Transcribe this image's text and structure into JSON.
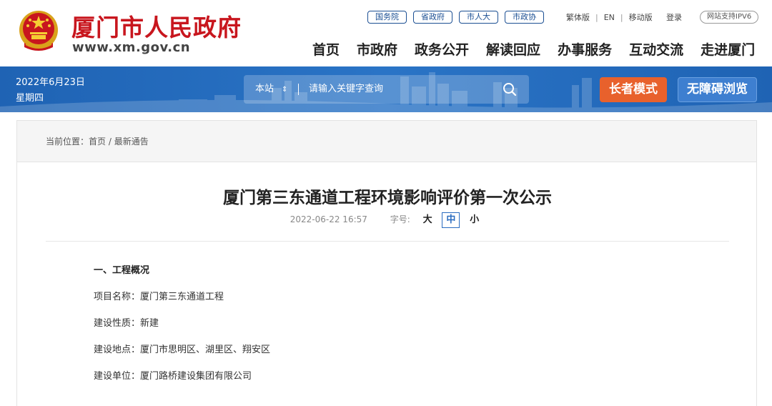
{
  "header": {
    "site_title": "厦门市人民政府",
    "site_domain": "www.xm.gov.cn",
    "top_links": [
      "国务院",
      "省政府",
      "市人大",
      "市政协"
    ],
    "util_links": [
      "繁体版",
      "EN",
      "移动版"
    ],
    "login": "登录",
    "ipv6": "网站支持IPV6",
    "nav": [
      "首页",
      "市政府",
      "政务公开",
      "解读回应",
      "办事服务",
      "互动交流",
      "走进厦门"
    ]
  },
  "band": {
    "date": "2022年6月23日",
    "weekday": "星期四",
    "search_scope": "本站",
    "search_placeholder": "请输入关键字查询",
    "elder_mode": "长者模式",
    "accessible": "无障碍浏览"
  },
  "breadcrumb": {
    "prefix": "当前位置：",
    "home": "首页",
    "separator": " / ",
    "current": "最新通告"
  },
  "article": {
    "title": "厦门第三东通道工程环境影响评价第一次公示",
    "datetime": "2022-06-22 16:57",
    "font_size_label": "字号:",
    "font_sizes": [
      "大",
      "中",
      "小"
    ],
    "active_font_size": "中",
    "paragraphs": [
      "一、工程概况",
      "项目名称：厦门第三东通道工程",
      "建设性质：新建",
      "建设地点：厦门市思明区、湖里区、翔安区",
      "建设单位：厦门路桥建设集团有限公司"
    ]
  },
  "colors": {
    "brand_red": "#c8161e",
    "band_blue": "#2a74c6",
    "elder_orange": "#e8612c",
    "link_blue": "#1b4f93"
  }
}
